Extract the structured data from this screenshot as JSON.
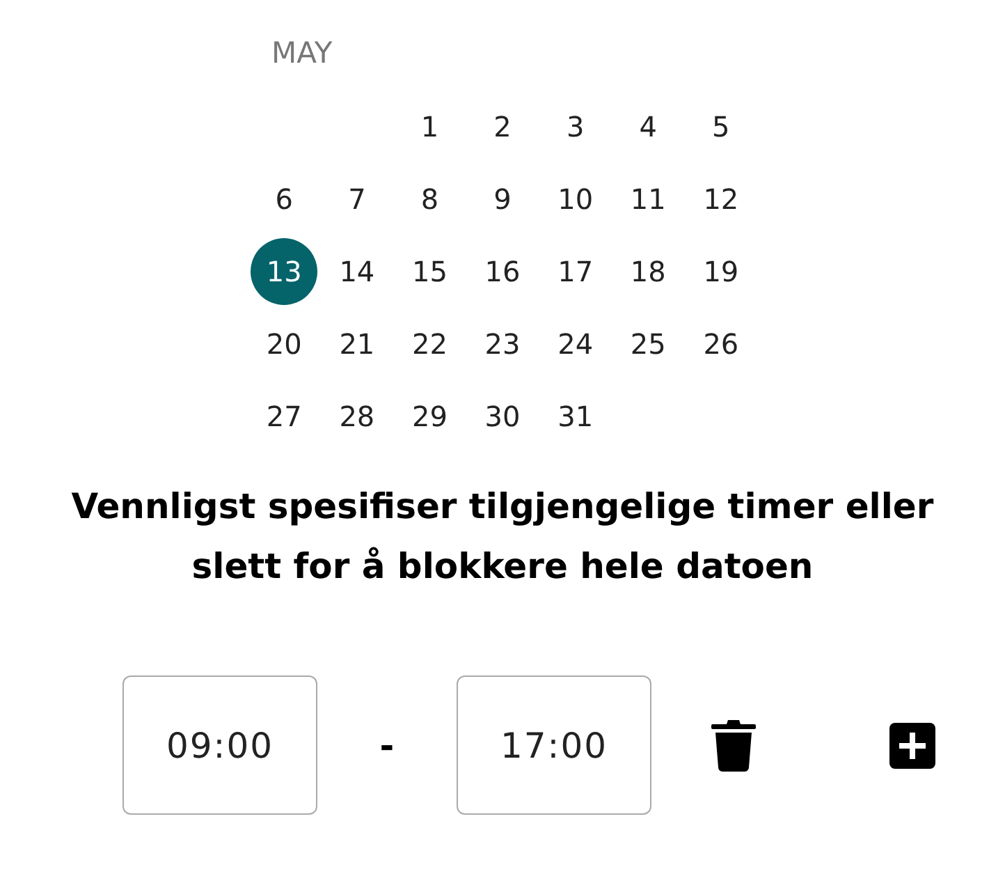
{
  "calendar": {
    "month": "MAY",
    "weeks": [
      {
        "align_end": true,
        "days": [
          {
            "label": "1",
            "selected": false
          },
          {
            "label": "2",
            "selected": false
          },
          {
            "label": "3",
            "selected": false
          },
          {
            "label": "4",
            "selected": false
          },
          {
            "label": "5",
            "selected": false
          }
        ]
      },
      {
        "days": [
          {
            "label": "6",
            "selected": false
          },
          {
            "label": "7",
            "selected": false
          },
          {
            "label": "8",
            "selected": false
          },
          {
            "label": "9",
            "selected": false
          },
          {
            "label": "10",
            "selected": false
          },
          {
            "label": "11",
            "selected": false
          },
          {
            "label": "12",
            "selected": false
          }
        ]
      },
      {
        "days": [
          {
            "label": "13",
            "selected": true
          },
          {
            "label": "14",
            "selected": false
          },
          {
            "label": "15",
            "selected": false
          },
          {
            "label": "16",
            "selected": false
          },
          {
            "label": "17",
            "selected": false
          },
          {
            "label": "18",
            "selected": false
          },
          {
            "label": "19",
            "selected": false
          }
        ]
      },
      {
        "days": [
          {
            "label": "20",
            "selected": false
          },
          {
            "label": "21",
            "selected": false
          },
          {
            "label": "22",
            "selected": false
          },
          {
            "label": "23",
            "selected": false
          },
          {
            "label": "24",
            "selected": false
          },
          {
            "label": "25",
            "selected": false
          },
          {
            "label": "26",
            "selected": false
          }
        ]
      },
      {
        "align_end": false,
        "days": [
          {
            "label": "27",
            "selected": false
          },
          {
            "label": "28",
            "selected": false
          },
          {
            "label": "29",
            "selected": false
          },
          {
            "label": "30",
            "selected": false
          },
          {
            "label": "31",
            "selected": false
          }
        ]
      }
    ]
  },
  "instruction": "Vennligst spesifiser tilgjengelige timer eller slett for å blokkere hele datoen",
  "time_slots": [
    {
      "start": "09:00",
      "separator": "-",
      "end": "17:00"
    }
  ]
}
